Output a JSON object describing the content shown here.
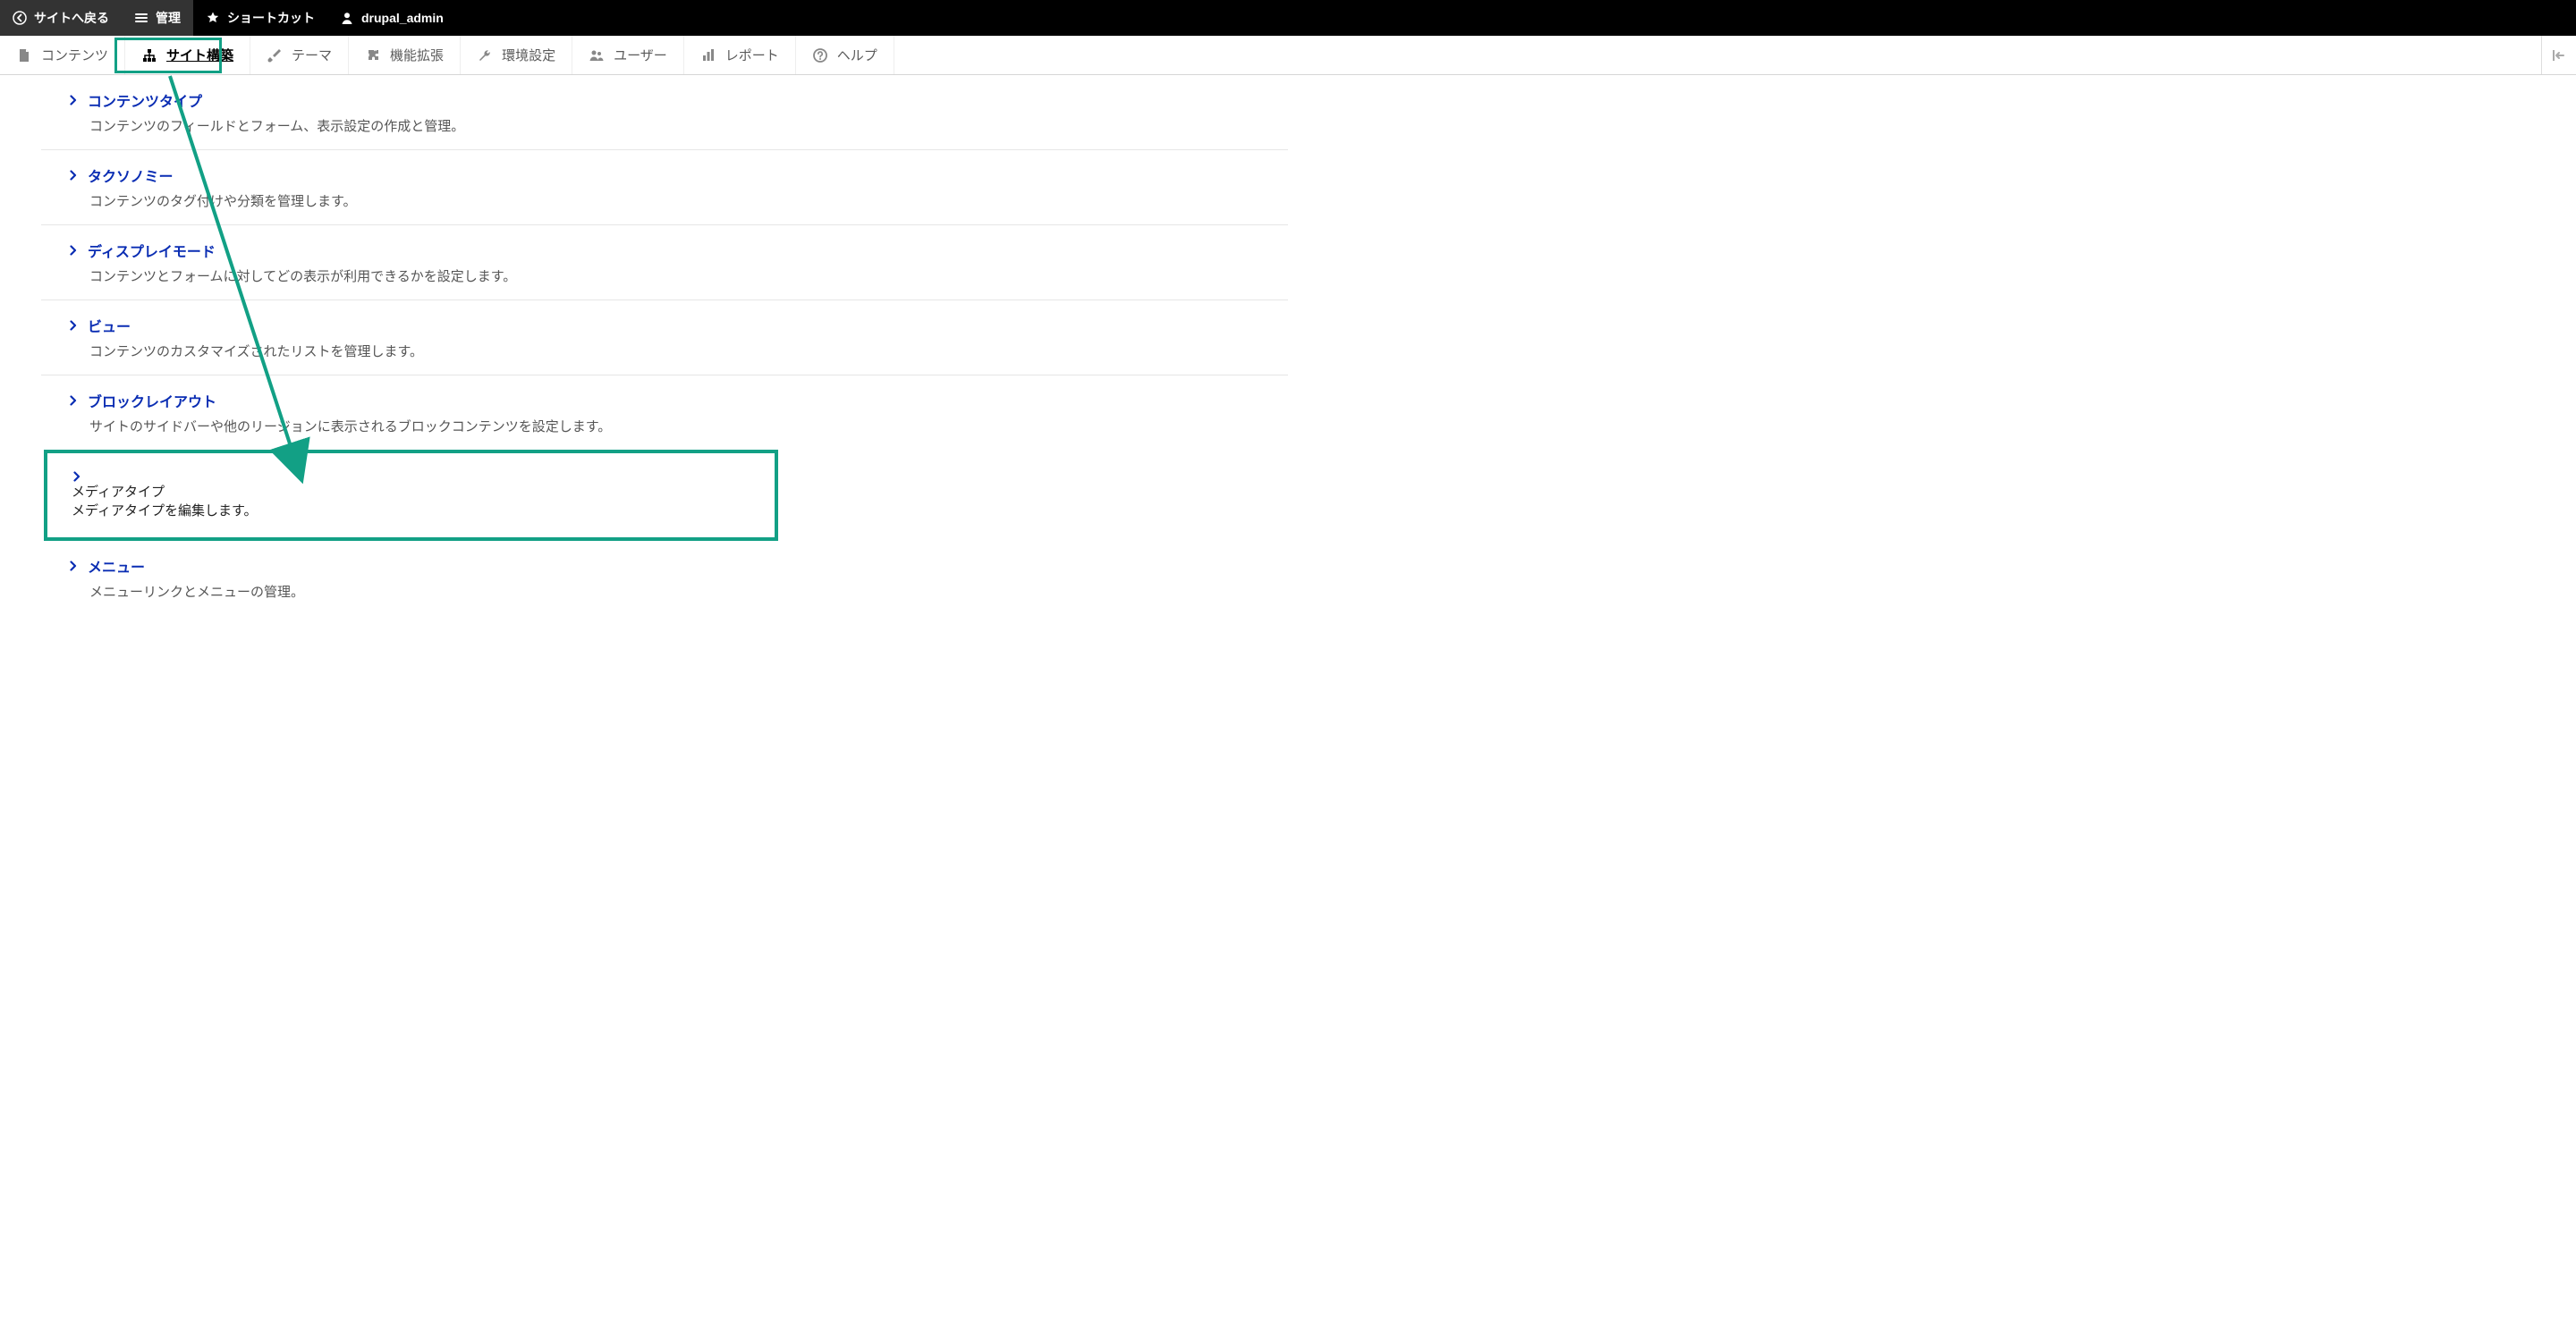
{
  "toolbar_top": {
    "back_label": "サイトへ戻る",
    "manage_label": "管理",
    "shortcut_label": "ショートカット",
    "user_label": "drupal_admin"
  },
  "admin_tabs": {
    "content": "コンテンツ",
    "structure": "サイト構築",
    "appearance": "テーマ",
    "extend": "機能拡張",
    "config": "環境設定",
    "people": "ユーザー",
    "reports": "レポート",
    "help": "ヘルプ"
  },
  "sections": [
    {
      "title": "コンテンツタイプ",
      "desc": "コンテンツのフィールドとフォーム、表示設定の作成と管理。"
    },
    {
      "title": "タクソノミー",
      "desc": "コンテンツのタグ付けや分類を管理します。"
    },
    {
      "title": "ディスプレイモード",
      "desc": "コンテンツとフォームに対してどの表示が利用できるかを設定します。"
    },
    {
      "title": "ビュー",
      "desc": "コンテンツのカスタマイズされたリストを管理します。"
    },
    {
      "title": "ブロックレイアウト",
      "desc": "サイトのサイドバーや他のリージョンに表示されるブロックコンテンツを設定します。"
    },
    {
      "title": "メディアタイプ",
      "desc": "メディアタイプを編集します。",
      "highlight": true
    },
    {
      "title": "メニュー",
      "desc": "メニューリンクとメニューの管理。"
    }
  ],
  "annotation": {
    "accent_color": "#12a085"
  }
}
